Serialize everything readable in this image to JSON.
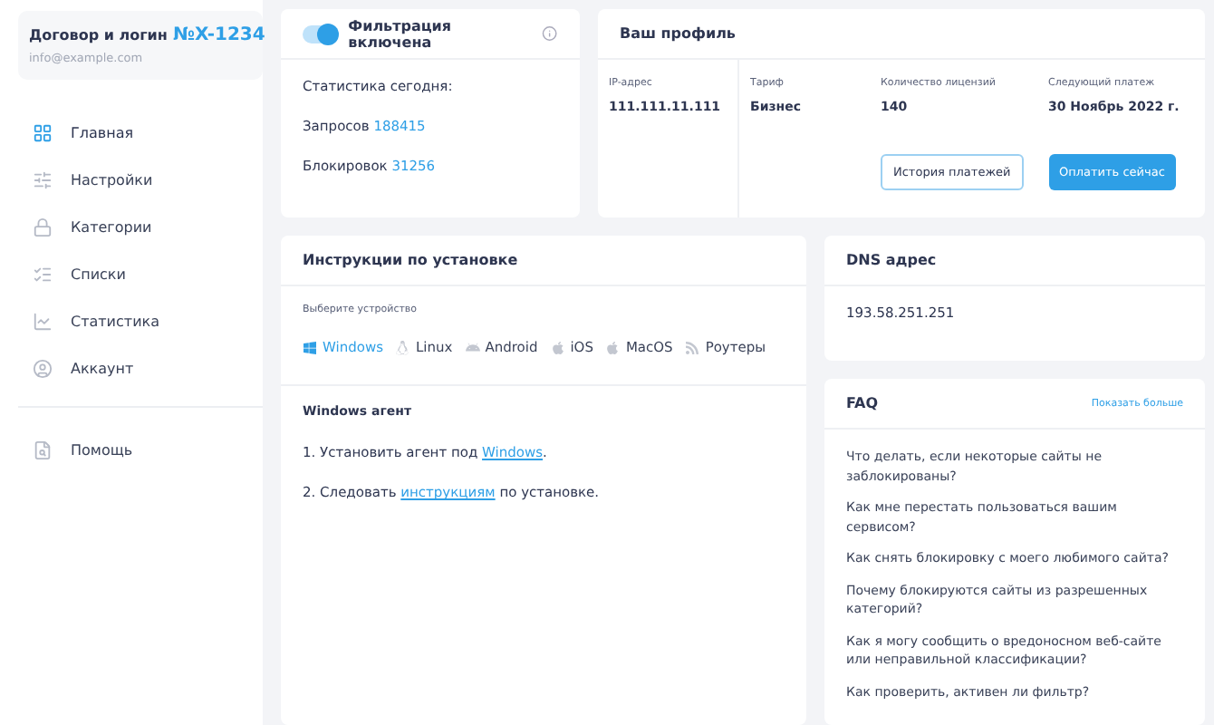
{
  "account": {
    "title": "Договор и логин",
    "number": "№X-1234",
    "email": "info@example.com"
  },
  "nav": [
    {
      "label": "Главная",
      "selected": true
    },
    {
      "label": "Настройки",
      "selected": false
    },
    {
      "label": "Категории",
      "selected": false
    },
    {
      "label": "Списки",
      "selected": false
    },
    {
      "label": "Статистика",
      "selected": false
    },
    {
      "label": "Аккаунт",
      "selected": false
    }
  ],
  "help": {
    "label": "Помощь"
  },
  "filter": {
    "on": true,
    "title": "Фильтрация включена",
    "stats_title": "Статистика сегодня:",
    "stats": [
      {
        "label": "Запросов",
        "value": "188415"
      },
      {
        "label": "Блокировок",
        "value": "31256"
      }
    ]
  },
  "profile": {
    "title": "Ваш профиль",
    "ip_label": "IP-адрес",
    "ip": "111.111.11.111",
    "fields": [
      {
        "label": "Тариф",
        "value": "Бизнес"
      },
      {
        "label": "Количество лицензий",
        "value": "140"
      },
      {
        "label": "Следующий платеж",
        "value": "30 Ноябрь 2022 г."
      }
    ],
    "history_button": "История платежей",
    "pay_button": "Оплатить сейчас"
  },
  "instructions": {
    "title": "Инструкции по установке",
    "device_hint": "Выберите устройство",
    "devices": [
      {
        "label": "Windows",
        "selected": true
      },
      {
        "label": "Linux",
        "selected": false
      },
      {
        "label": "Android",
        "selected": false
      },
      {
        "label": "iOS",
        "selected": false
      },
      {
        "label": "MacOS",
        "selected": false
      },
      {
        "label": "Роутеры",
        "selected": false
      }
    ],
    "agent_title": "Windows агент",
    "steps": [
      {
        "before": "1. Установить агент под ",
        "link": "Windows",
        "after": "."
      },
      {
        "before": "2. Следовать ",
        "link": "инструкциям",
        "after": " по установке."
      }
    ]
  },
  "dns": {
    "title": "DNS адрес",
    "value": "193.58.251.251"
  },
  "faq": {
    "title": "FAQ",
    "more": "Показать больше",
    "items": [
      "Что делать, если некоторые сайты не заблокированы?",
      "Как мне перестать пользоваться вашим сервисом?",
      "Как снять блокировку с моего любимого сайта?",
      "Почему блокируются сайты из разрешенных категорий?",
      "Как я могу сообщить о вредоносном веб-сайте или неправильной классификации?",
      "Как проверить, активен ли фильтр?"
    ]
  }
}
